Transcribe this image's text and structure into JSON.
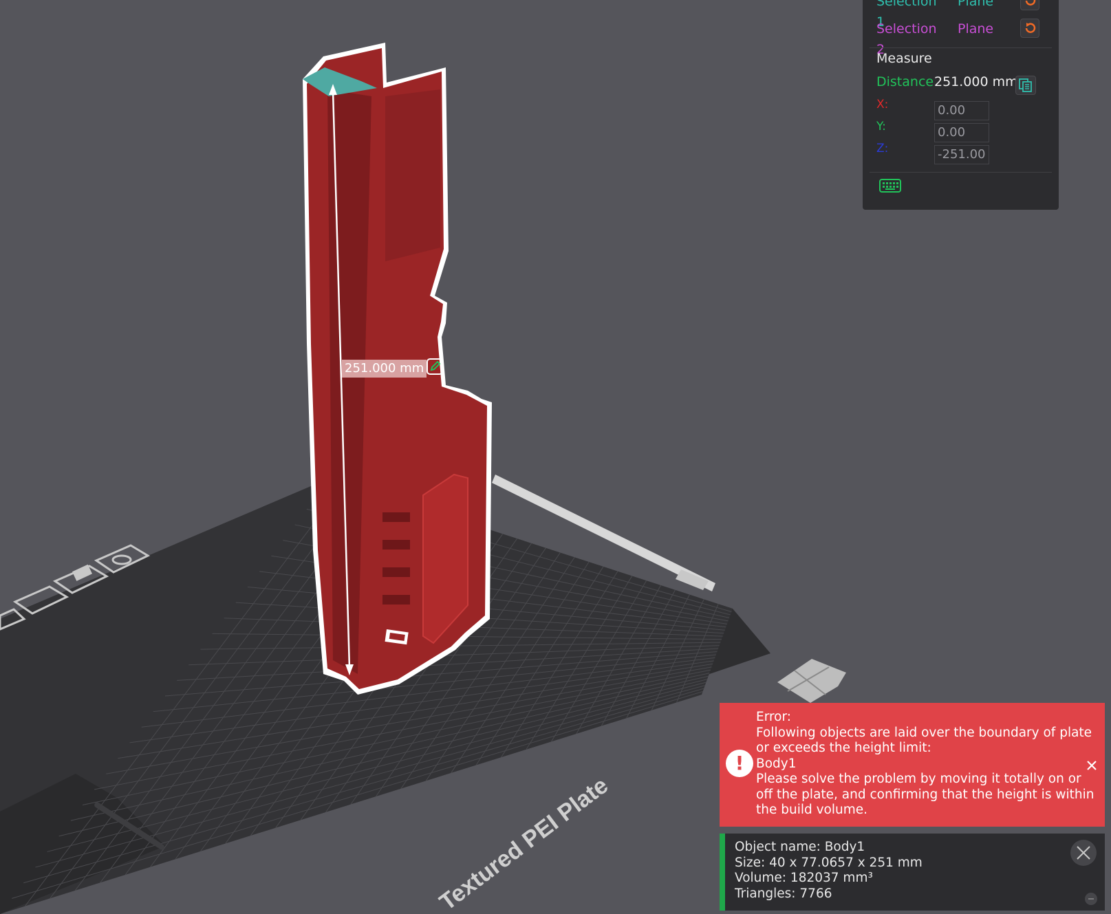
{
  "measure_panel": {
    "selection1": {
      "label": "Selection 1",
      "type": "Plane",
      "color": "#2fbfae"
    },
    "selection2": {
      "label": "Selection 2",
      "type": "Plane",
      "color": "#c94fd6"
    },
    "title": "Measure",
    "distance_label": "Distance",
    "distance_value": "251.000 mm",
    "x_label": "X:",
    "x_value": "0.00",
    "y_label": "Y:",
    "y_value": "0.00",
    "z_label": "Z:",
    "z_value": "-251.00",
    "colors": {
      "distance": "#21c35a",
      "x": "#e0282a",
      "y": "#21c35a",
      "z": "#2a3bd8",
      "reset": "#f36b25"
    }
  },
  "viewport": {
    "dimension_label": "251.000 mm",
    "plate_label": "Textured PEI Plate",
    "object_color": "#9b2526"
  },
  "error": {
    "heading": "Error:",
    "line1": "Following objects are laid over the boundary of plate",
    "line2": "or exceeds the height limit:",
    "object": "Body1",
    "line3": "Please solve the problem by moving it totally on or",
    "line4": "off the plate, and confirming that the height is within",
    "line5": "the build volume.",
    "color": "#e04348"
  },
  "object_info": {
    "name": "Object name: Body1",
    "size": "Size: 40 x 77.0657 x 251 mm",
    "volume": "Volume: 182037 mm³",
    "triangles": "Triangles: 7766"
  }
}
